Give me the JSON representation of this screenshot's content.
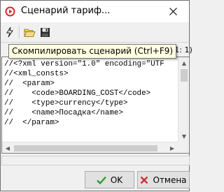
{
  "window": {
    "title": "Сценарий тариф..."
  },
  "toolbar": {
    "buttons": [
      {
        "name": "compile-button",
        "icon": "lightning-icon"
      },
      {
        "name": "open-button",
        "icon": "folder-open-icon"
      },
      {
        "name": "save-button",
        "icon": "floppy-disk-icon"
      }
    ],
    "tooltip": "Скомпилировать сценарий (Ctrl+F9)"
  },
  "editor": {
    "cursor_position": "(1: 1)",
    "lines": [
      "//<?xml version=\"1.0\" encoding=\"UTF",
      "//<xml_consts>",
      "//  <param>",
      "//    <code>BOARDING_COST</code>",
      "//    <type>currency</type>",
      "//    <name>Посадка</name>",
      "//  </param>"
    ]
  },
  "buttons": {
    "ok_label": "OK",
    "cancel_label": "Отмена"
  },
  "colors": {
    "ok_check": "#2e9e2e",
    "cancel_x": "#d03030",
    "tooltip_bg": "#ffffe1",
    "app_icon": "#d42b2b"
  }
}
